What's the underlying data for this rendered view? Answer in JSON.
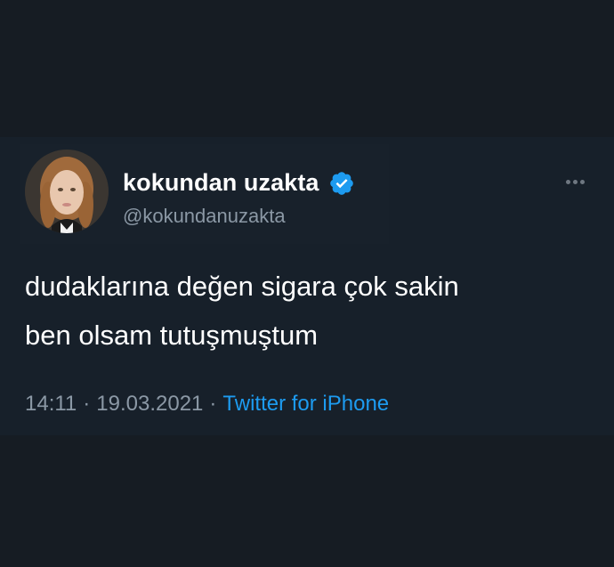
{
  "tweet": {
    "display_name": "kokundan uzakta",
    "handle": "@kokundanuzakta",
    "verified": true,
    "text_lines": [
      "dudaklarına değen sigara çok sakin",
      "ben olsam tutuşmuştum"
    ],
    "time": "14:11",
    "date": "19.03.2021",
    "separator": "·",
    "source": "Twitter for iPhone"
  },
  "icons": {
    "verified": "verified-badge-icon",
    "more": "more-options-icon"
  },
  "colors": {
    "background": "#161c23",
    "card": "#17202a",
    "name": "#ffffff",
    "secondary": "#8b98a5",
    "accent": "#1d9bf0"
  }
}
